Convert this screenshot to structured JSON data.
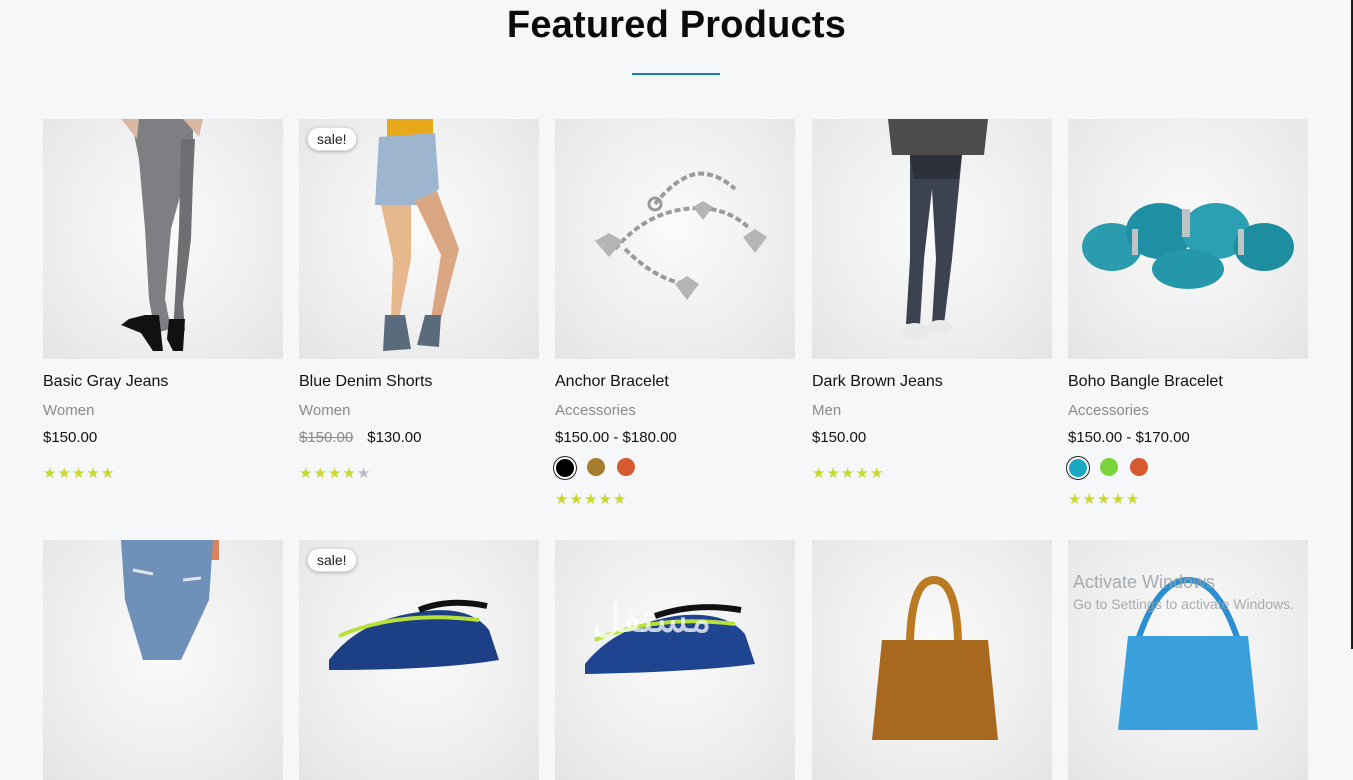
{
  "section": {
    "title": "Featured Products"
  },
  "colors": {
    "accent": "#1a7bc0",
    "star": "#c8d82d",
    "star_empty": "#b9bcc0"
  },
  "products": [
    {
      "name": "Basic Gray Jeans",
      "category": "Women",
      "price": "$150.00",
      "rating": 5,
      "image_icon": "gray-jeans-photo"
    },
    {
      "name": "Blue Denim Shorts",
      "category": "Women",
      "old_price": "$150.00",
      "price": "$130.00",
      "rating": 4,
      "badge": "sale!",
      "image_icon": "denim-shorts-photo"
    },
    {
      "name": "Anchor Bracelet",
      "category": "Accessories",
      "price": "$150.00 - $180.00",
      "rating": 5,
      "swatches": [
        "#000000",
        "#a67c2e",
        "#d55a2e"
      ],
      "image_icon": "chain-bracelet-photo"
    },
    {
      "name": "Dark Brown Jeans",
      "category": "Men",
      "price": "$150.00",
      "rating": 5,
      "image_icon": "dark-jeans-photo"
    },
    {
      "name": "Boho Bangle Bracelet",
      "category": "Accessories",
      "price": "$150.00 - $170.00",
      "rating": 5,
      "swatches": [
        "#1aa7c1",
        "#7bd43c",
        "#d55a2e"
      ],
      "image_icon": "turquoise-bracelet-photo"
    }
  ],
  "second_row": [
    {
      "image_icon": "ripped-jeans-photo"
    },
    {
      "badge": "sale!",
      "image_icon": "sneaker-photo"
    },
    {
      "image_icon": "sneaker-photo"
    },
    {
      "image_icon": "leather-handbag-photo"
    },
    {
      "image_icon": "blue-handbag-photo"
    }
  ],
  "overlay": {
    "windows_line1": "Activate Windows",
    "windows_line2": "Go to Settings to activate Windows.",
    "arabic_watermark": "مستقل"
  }
}
